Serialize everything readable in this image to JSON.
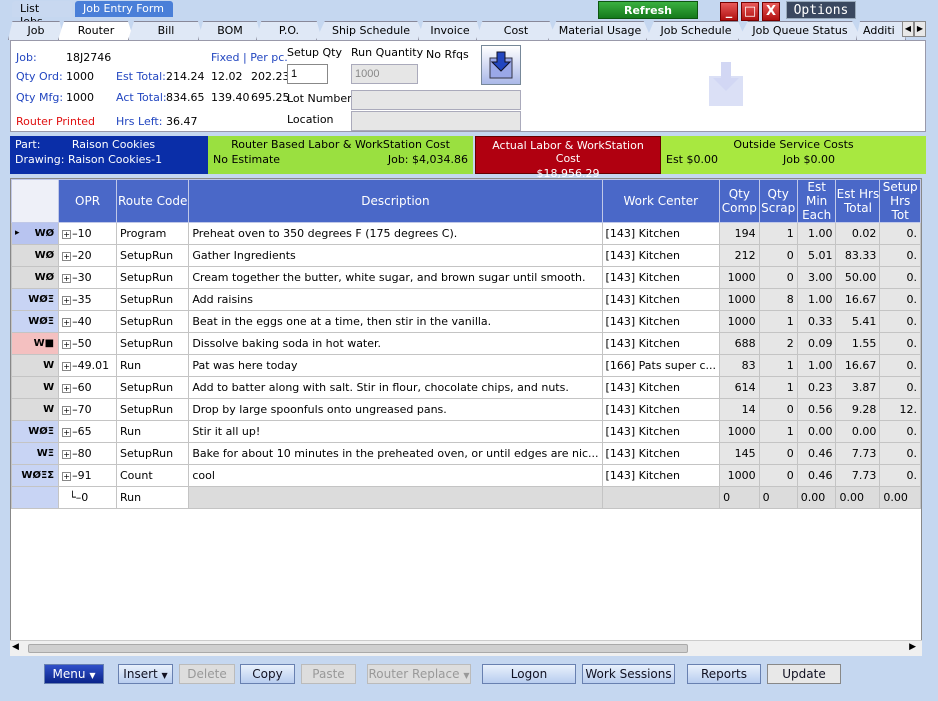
{
  "top_tabs": [
    "List Jobs",
    "Job Entry Form"
  ],
  "refresh_label": "Refresh",
  "options_label": "Options",
  "window_buttons": {
    "minimize": "_",
    "restore": "□",
    "close": "X"
  },
  "nav_tabs": [
    "Job",
    "Router",
    "Bill",
    "BOM",
    "P.O.",
    "Ship Schedule",
    "Invoice",
    "Cost",
    "Material Usage",
    "Job Schedule",
    "Job Queue Status",
    "Additi"
  ],
  "header": {
    "job_label": "Job:",
    "job_value": "18J2746",
    "qty_ord_label": "Qty Ord:",
    "qty_ord_value": "1000",
    "qty_mfg_label": "Qty Mfg:",
    "qty_mfg_value": "1000",
    "router_printed": "Router Printed",
    "fixed_per": "Fixed | Per pc.",
    "est_total_label": "Est Total:",
    "est_total_value": "214.24",
    "est_fixed": "12.02",
    "est_per": "202.23",
    "act_total_label": "Act Total:",
    "act_total_value": "834.65",
    "act_fixed": "139.40",
    "act_per": "695.25",
    "hrs_left_label": "Hrs Left:",
    "hrs_left_value": "36.47",
    "setup_qty_label": "Setup Qty",
    "setup_qty_value": "1",
    "run_qty_label": "Run Quantity",
    "run_qty_value": "1000",
    "no_rfqs": "No Rfqs",
    "lot_label": "Lot Number",
    "location_label": "Location"
  },
  "summary": {
    "part_label": "Part:",
    "part_value": "Raison Cookies",
    "drawing_label": "Drawing:",
    "drawing_value": "Raison Cookies-1",
    "router_cost_title": "Router Based Labor & WorkStation Cost",
    "router_cost_left": "No Estimate",
    "router_cost_right": "Job: $4,034.86",
    "actual_title": "Actual Labor & WorkStation Cost",
    "actual_value": "$18,956.29",
    "outside_title": "Outside Service Costs",
    "outside_est": "Est $0.00",
    "outside_job": "Job $0.00"
  },
  "columns": [
    "OPR",
    "Route Code",
    "Description",
    "Work Center",
    "Qty Comp",
    "Qty Scrap",
    "Est Min Each",
    "Est Hrs Total",
    "Setup Hrs Tot"
  ],
  "rows": [
    {
      "icon": "WØ",
      "opr": "10",
      "code": "Program",
      "desc": "Preheat oven to 350 degrees F (175 degrees C).",
      "wc": "[143] Kitchen",
      "comp": "194",
      "scrap": "1",
      "min": "1.00",
      "hrs": "0.02",
      "setup": "0.",
      "bg": "#b8c4f0"
    },
    {
      "icon": "WØ",
      "opr": "20",
      "code": "SetupRun",
      "desc": "Gather Ingredients",
      "wc": "[143] Kitchen",
      "comp": "212",
      "scrap": "0",
      "min": "5.01",
      "hrs": "83.33",
      "setup": "0.",
      "bg": "#dcdcdc"
    },
    {
      "icon": "WØ",
      "opr": "30",
      "code": "SetupRun",
      "desc": "Cream together the butter, white sugar, and brown sugar until smooth.",
      "wc": "[143] Kitchen",
      "comp": "1000",
      "scrap": "0",
      "min": "3.00",
      "hrs": "50.00",
      "setup": "0.",
      "bg": "#dcdcdc"
    },
    {
      "icon": "WØΞ",
      "opr": "35",
      "code": "SetupRun",
      "desc": "Add raisins",
      "wc": "[143] Kitchen",
      "comp": "1000",
      "scrap": "8",
      "min": "1.00",
      "hrs": "16.67",
      "setup": "0.",
      "bg": "#c8d4f4"
    },
    {
      "icon": "WØΞ",
      "opr": "40",
      "code": "SetupRun",
      "desc": "Beat in the eggs one at a time, then stir in the vanilla.",
      "wc": "[143] Kitchen",
      "comp": "1000",
      "scrap": "1",
      "min": "0.33",
      "hrs": "5.41",
      "setup": "0.",
      "bg": "#c8d4f4"
    },
    {
      "icon": "W■",
      "opr": "50",
      "code": "SetupRun",
      "desc": "Dissolve baking soda in hot water.",
      "wc": "[143] Kitchen",
      "comp": "688",
      "scrap": "2",
      "min": "0.09",
      "hrs": "1.55",
      "setup": "0.",
      "bg": "#f4c0c0"
    },
    {
      "icon": "W",
      "opr": "49.01",
      "code": "Run",
      "desc": "Pat was here today",
      "wc": "[166] Pats super c...",
      "comp": "83",
      "scrap": "1",
      "min": "1.00",
      "hrs": "16.67",
      "setup": "0.",
      "bg": "#dcdcdc"
    },
    {
      "icon": "W",
      "opr": "60",
      "code": "SetupRun",
      "desc": "Add to batter along with salt. Stir in flour, chocolate chips, and nuts.",
      "wc": "[143] Kitchen",
      "comp": "614",
      "scrap": "1",
      "min": "0.23",
      "hrs": "3.87",
      "setup": "0.",
      "bg": "#dcdcdc"
    },
    {
      "icon": "W",
      "opr": "70",
      "code": "SetupRun",
      "desc": "Drop by large spoonfuls onto ungreased pans.",
      "wc": "[143] Kitchen",
      "comp": "14",
      "scrap": "0",
      "min": "0.56",
      "hrs": "9.28",
      "setup": "12.",
      "bg": "#dcdcdc"
    },
    {
      "icon": "WØΞ",
      "opr": "65",
      "code": "Run",
      "desc": "Stir it all up!",
      "wc": "[143] Kitchen",
      "comp": "1000",
      "scrap": "1",
      "min": "0.00",
      "hrs": "0.00",
      "setup": "0.",
      "bg": "#c8d4f4"
    },
    {
      "icon": "WΞ",
      "opr": "80",
      "code": "SetupRun",
      "desc": "Bake for about 10 minutes in the preheated oven, or until edges are nic...",
      "wc": "[143] Kitchen",
      "comp": "145",
      "scrap": "0",
      "min": "0.46",
      "hrs": "7.73",
      "setup": "0.",
      "bg": "#c8d4f4"
    },
    {
      "icon": "WØΞΣ",
      "opr": "91",
      "code": "Count",
      "desc": "cool",
      "wc": "[143] Kitchen",
      "comp": "1000",
      "scrap": "0",
      "min": "0.46",
      "hrs": "7.73",
      "setup": "0.",
      "bg": "#c8d4f4"
    }
  ],
  "new_row": {
    "opr": "0",
    "code": "Run",
    "comp": "0",
    "scrap": "0",
    "min": "0.00",
    "hrs": "0.00",
    "setup": "0.00"
  },
  "buttons": {
    "menu": "Menu",
    "insert": "Insert",
    "delete": "Delete",
    "copy": "Copy",
    "paste": "Paste",
    "router_replace": "Router Replace",
    "logon": "Logon",
    "work_sessions": "Work Sessions",
    "reports": "Reports",
    "update": "Update"
  },
  "colors": {
    "accent": "#4a68c8",
    "part_bg": "#0a2ea8",
    "router_bg": "#9ae040",
    "actual_bg": "#b00010",
    "outside_bg": "#a8e840"
  }
}
